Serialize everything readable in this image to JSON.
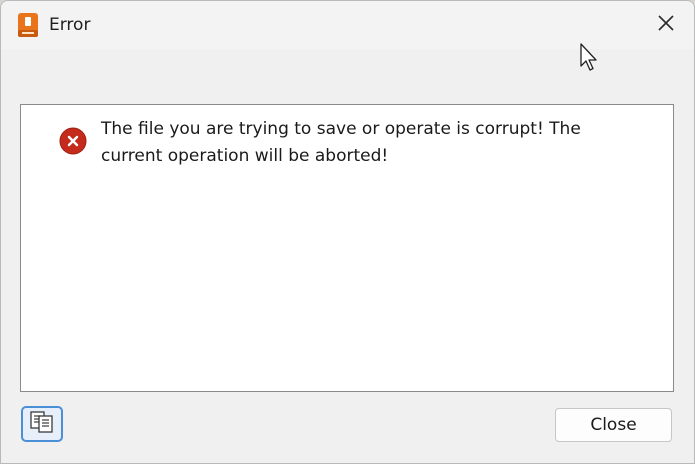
{
  "window": {
    "title": "Error",
    "app_icon": "app-document-icon",
    "close_icon": "close-icon"
  },
  "message": {
    "icon": "error-icon",
    "text": "The file you are trying to save or operate is corrupt! The current operation will be aborted!"
  },
  "footer": {
    "copy_icon": "copy-icon",
    "close_label": "Close"
  },
  "colors": {
    "error_red": "#c42b1c",
    "accent_blue": "#4b8fd6",
    "app_orange": "#e8741c"
  }
}
